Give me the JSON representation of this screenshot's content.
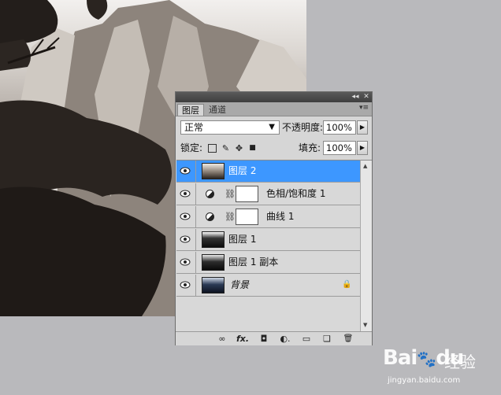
{
  "panel": {
    "tabs": [
      {
        "label": "图层",
        "active": true
      },
      {
        "label": "通道",
        "active": false
      }
    ],
    "titlebar": {
      "collapse": "◂◂",
      "close": "✕"
    },
    "menu_icon": "panel-menu-icon",
    "blend_mode": "正常",
    "opacity_label": "不透明度:",
    "opacity_value": "100%",
    "lock_label": "锁定:",
    "fill_label": "填充:",
    "fill_value": "100%",
    "layers": [
      {
        "name": "图层 2",
        "type": "pixel",
        "selected": true,
        "visible": true
      },
      {
        "name": "色相/饱和度 1",
        "type": "adjustment",
        "selected": false,
        "visible": true
      },
      {
        "name": "曲线 1",
        "type": "adjustment",
        "selected": false,
        "visible": true
      },
      {
        "name": "图层 1",
        "type": "pixel",
        "selected": false,
        "visible": true
      },
      {
        "name": "图层 1 副本",
        "type": "pixel",
        "selected": false,
        "visible": true
      },
      {
        "name": "背景",
        "type": "background",
        "selected": false,
        "visible": true,
        "locked": true
      }
    ],
    "toolbar": {
      "link": "∞",
      "fx": "fx.",
      "mask": "◘",
      "adjust": "◐.",
      "group": "▭",
      "new": "❏",
      "delete": "🗑"
    },
    "colors": {
      "selected": "#3d97ff",
      "panel_bg": "#d6d6d6",
      "titlebar": "#4a4a4a"
    }
  },
  "watermark": {
    "brand": "Bai",
    "paw": "du",
    "jingyan": "经验",
    "url": "jingyan.baidu.com"
  }
}
